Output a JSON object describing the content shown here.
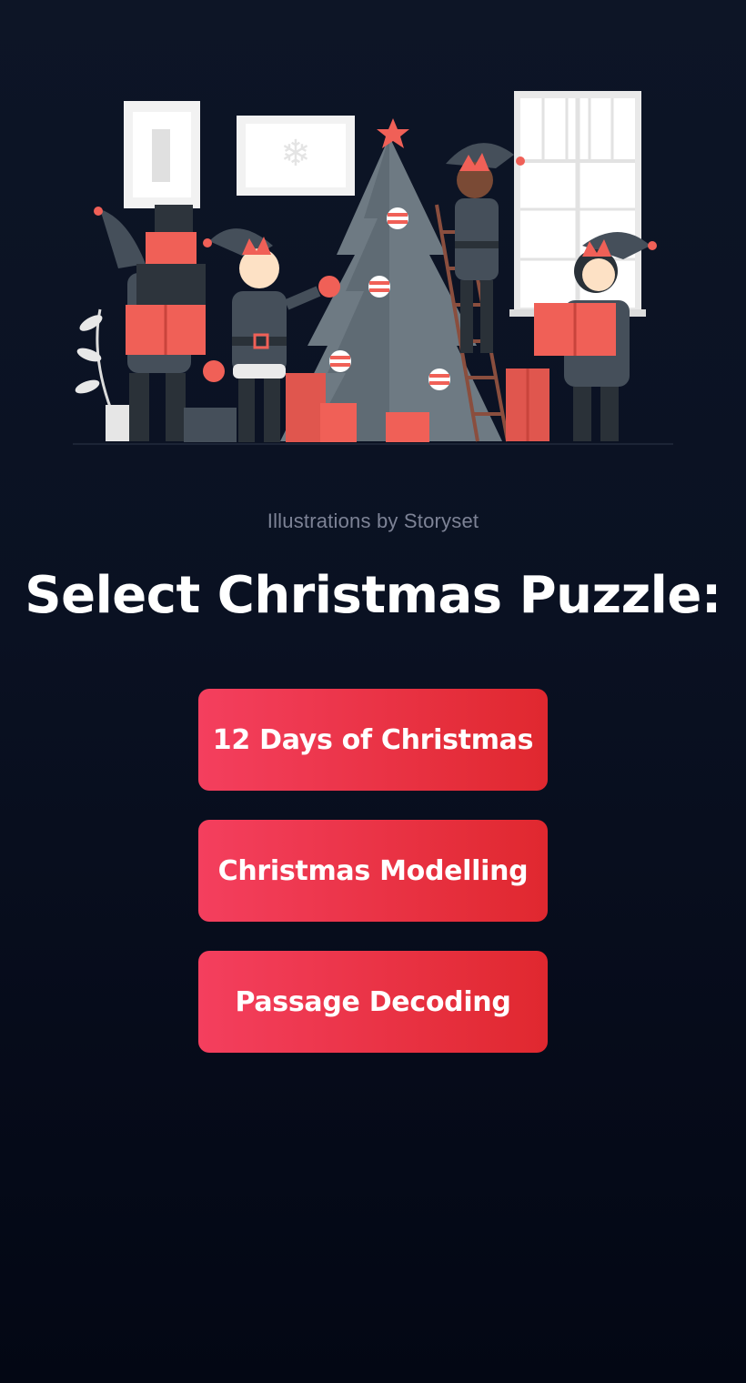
{
  "illustration": {
    "alt": "Elves decorating a Christmas tree with presents"
  },
  "credit": "Illustrations by Storyset",
  "title": "Select Christmas Puzzle:",
  "puzzles": [
    {
      "label": "12 Days of Christmas"
    },
    {
      "label": "Christmas Modelling"
    },
    {
      "label": "Passage Decoding"
    }
  ],
  "colors": {
    "background_top": "#0d1526",
    "background_bottom": "#030714",
    "button_start": "#f43f5e",
    "button_end": "#e0282f",
    "accent_red": "#f06057",
    "elf_gray": "#454f5a"
  }
}
